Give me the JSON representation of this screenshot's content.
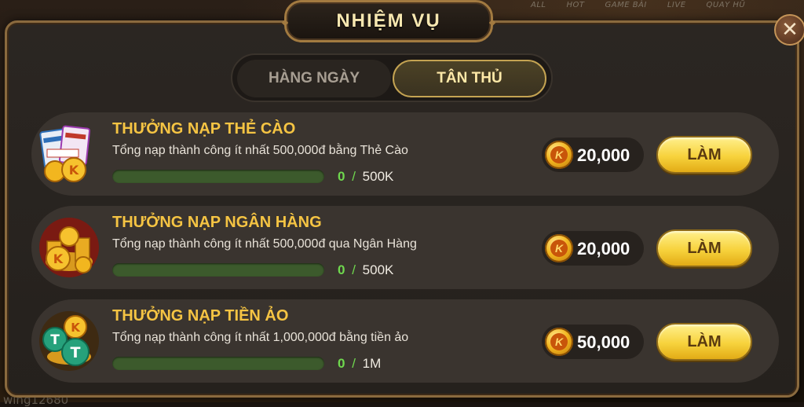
{
  "background": {
    "nav": [
      "ALL",
      "HOT",
      "GAME BÀI",
      "LIVE",
      "QUAY HŨ"
    ],
    "username": "wing12680"
  },
  "header": {
    "title": "NHIỆM VỤ",
    "close_label": "✕"
  },
  "tabs": [
    {
      "label": "HÀNG NGÀY",
      "active": false
    },
    {
      "label": "TÂN THỦ",
      "active": true
    }
  ],
  "quests": [
    {
      "title": "THƯỞNG NẠP THẺ CÀO",
      "description": "Tổng nạp thành công ít nhất 500,000đ bằng Thẻ Cào",
      "progress_current": "0",
      "progress_sep": "/",
      "progress_total": "500K",
      "progress_fraction": 0,
      "reward": "20,000",
      "action_label": "LÀM",
      "icon": "scratch-card-icon"
    },
    {
      "title": "THƯỞNG NẠP NGÂN HÀNG",
      "description": "Tổng nạp thành công ít nhất 500,000đ qua Ngân Hàng",
      "progress_current": "0",
      "progress_sep": "/",
      "progress_total": "500K",
      "progress_fraction": 0,
      "reward": "20,000",
      "action_label": "LÀM",
      "icon": "gold-coins-icon"
    },
    {
      "title": "THƯỞNG NẠP TIỀN ẢO",
      "description": "Tổng nạp thành công ít nhất 1,000,000đ bằng tiền ảo",
      "progress_current": "0",
      "progress_sep": "/",
      "progress_total": "1M",
      "progress_fraction": 0,
      "reward": "50,000",
      "action_label": "LÀM",
      "icon": "crypto-coins-icon"
    }
  ],
  "coin_symbol": "K",
  "colors": {
    "accent_gold": "#f5c443",
    "progress_green": "#6fd84e",
    "button_yellow": "#f7d23c"
  }
}
